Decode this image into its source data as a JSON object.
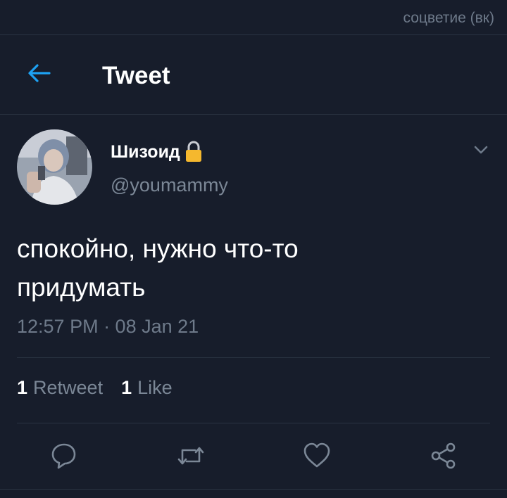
{
  "watermark": "соцветие (вк)",
  "header": {
    "title": "Tweet",
    "back_icon": "arrow-left-icon",
    "accent": "#1da1f2"
  },
  "author": {
    "name": "Шизоид",
    "handle": "@youmammy",
    "protected_icon": "lock-icon",
    "menu_icon": "chevron-down-icon"
  },
  "tweet": {
    "text_line1": "спокойно, нужно что-то",
    "text_line2": "придумать",
    "timestamp": "12:57 PM · 08 Jan 21"
  },
  "stats": {
    "retweet_count": "1",
    "retweet_label": "Retweet",
    "like_count": "1",
    "like_label": "Like"
  },
  "actions": {
    "reply_icon": "reply-icon",
    "retweet_icon": "retweet-icon",
    "like_icon": "heart-icon",
    "share_icon": "share-icon"
  },
  "colors": {
    "background": "#171d2b",
    "text_primary": "#ffffff",
    "text_secondary": "#7b8796",
    "divider": "#2a3342",
    "lock": "#f5b82e"
  }
}
